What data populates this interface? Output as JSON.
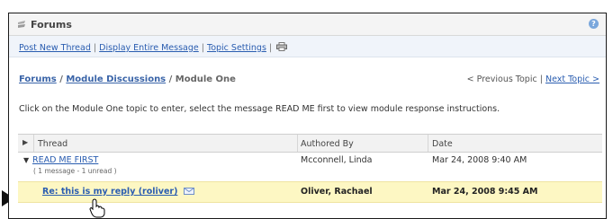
{
  "window": {
    "title": "Forums"
  },
  "toolbar": {
    "post_new_thread": "Post New Thread",
    "display_entire_message": "Display Entire Message",
    "topic_settings": "Topic Settings",
    "sep": "|",
    "print_icon": "printer-icon"
  },
  "breadcrumb": {
    "forums": "Forums",
    "sep": "/",
    "module_discussions": "Module Discussions",
    "current": "Module One"
  },
  "topic_nav": {
    "previous": "< Previous Topic",
    "sep": "|",
    "next": "Next Topic >"
  },
  "instructions": "Click on the Module One topic to enter, select the message READ ME first to view module response instructions.",
  "table": {
    "columns": [
      "Thread",
      "Authored By",
      "Date"
    ],
    "rows": [
      {
        "subject": "READ ME FIRST",
        "meta": "( 1 message - 1 unread )",
        "author": "Mcconnell, Linda",
        "date": "Mar 24, 2008 9:40 AM"
      },
      {
        "subject": "Re: this is my reply (roliver)",
        "author": "Oliver, Rachael",
        "date": "Mar 24, 2008 9:45 AM",
        "icon": "envelope-icon"
      }
    ]
  },
  "colors": {
    "link": "#2a5db0",
    "highlight_row": "#fdf7c3",
    "toolbar_bg": "#f0f4fa"
  }
}
